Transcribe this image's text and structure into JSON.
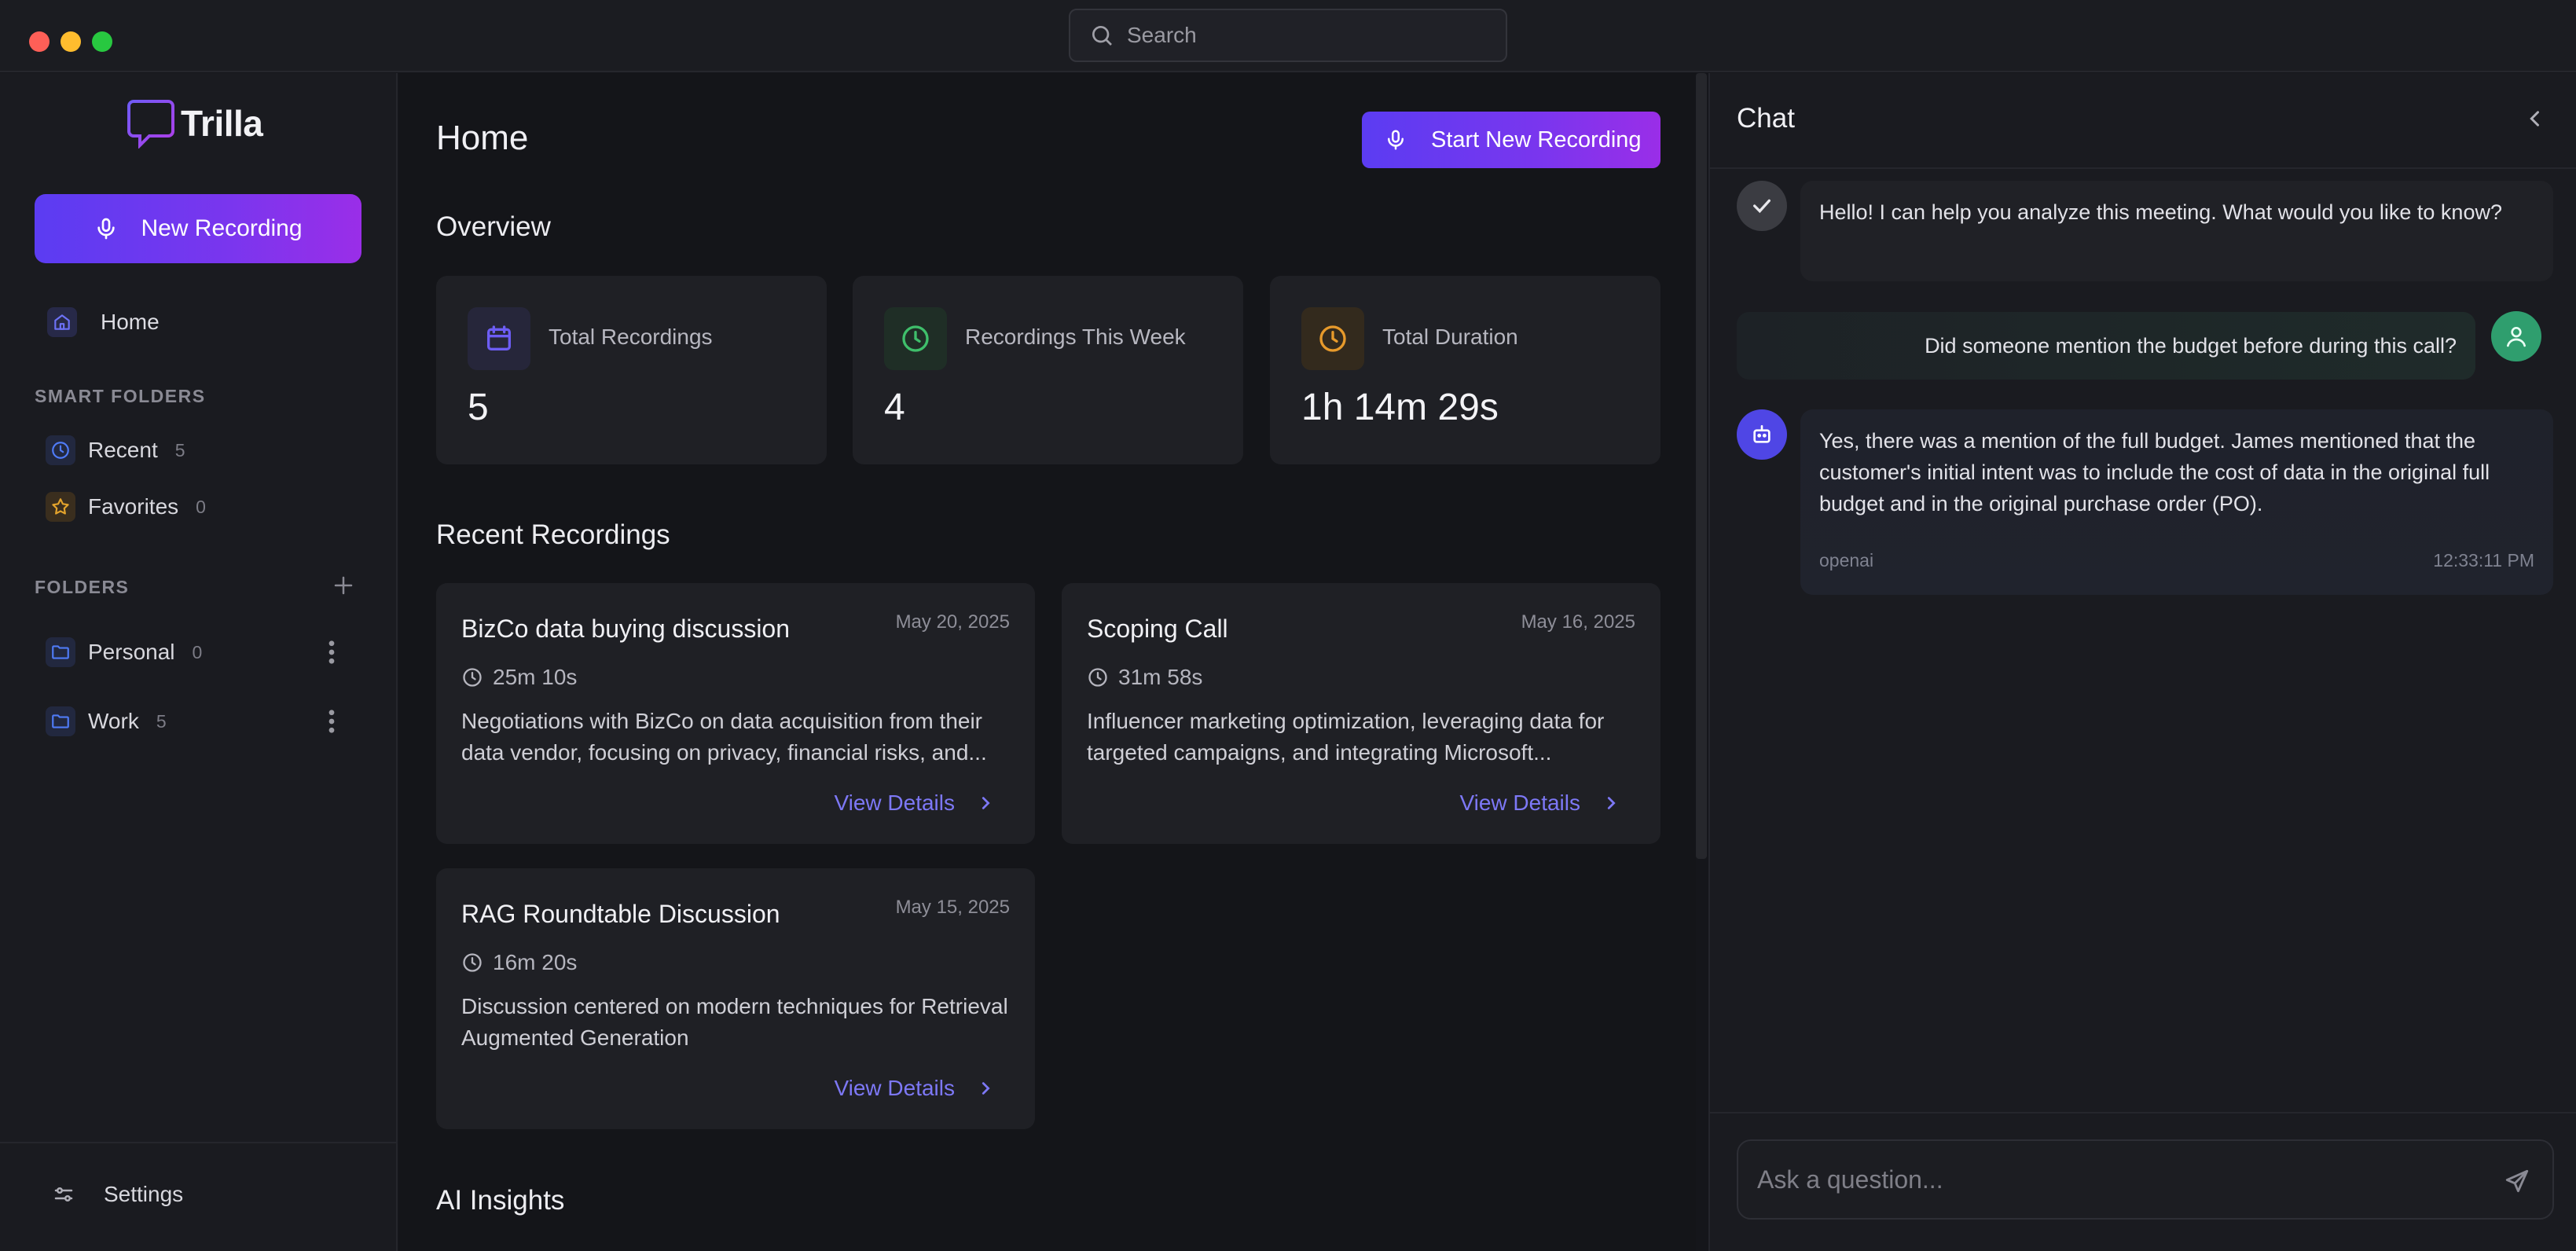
{
  "search": {
    "placeholder": "Search"
  },
  "sidebar": {
    "app_name": "Trilla",
    "new_recording_label": "New Recording",
    "home_label": "Home",
    "smart_folders_label": "SMART FOLDERS",
    "smart_folders": [
      {
        "label": "Recent",
        "count": "5",
        "icon": "clock-icon",
        "color": "#4f7bf7"
      },
      {
        "label": "Favorites",
        "count": "0",
        "icon": "star-icon",
        "color": "#e3a32c"
      }
    ],
    "folders_label": "FOLDERS",
    "folders": [
      {
        "label": "Personal",
        "count": "0",
        "icon": "folder-icon"
      },
      {
        "label": "Work",
        "count": "5",
        "icon": "folder-icon"
      }
    ],
    "settings_label": "Settings"
  },
  "main": {
    "title": "Home",
    "start_recording_label": "Start New Recording",
    "overview_label": "Overview",
    "stats": [
      {
        "label": "Total Recordings",
        "value": "5",
        "icon": "calendar-icon",
        "color": "#6d5df5"
      },
      {
        "label": "Recordings This Week",
        "value": "4",
        "icon": "clock-icon",
        "color": "#3fbf6b"
      },
      {
        "label": "Total Duration",
        "value": "1h 14m 29s",
        "icon": "clock-icon",
        "color": "#e79a2b"
      }
    ],
    "recent_label": "Recent Recordings",
    "recordings": [
      {
        "title": "BizCo data buying discussion",
        "date": "May 20, 2025",
        "duration": "25m 10s",
        "description": "Negotiations with BizCo on data acquisition from their data vendor, focusing on privacy, financial risks, and...",
        "link": "View Details"
      },
      {
        "title": "Scoping Call",
        "date": "May 16, 2025",
        "duration": "31m 58s",
        "description": "Influencer marketing optimization, leveraging data for targeted campaigns, and integrating Microsoft...",
        "link": "View Details"
      },
      {
        "title": "RAG Roundtable Discussion",
        "date": "May 15, 2025",
        "duration": "16m 20s",
        "description": "Discussion centered on modern techniques for Retrieval Augmented Generation",
        "link": "View Details"
      }
    ],
    "ai_insights_label": "AI Insights"
  },
  "chat": {
    "title": "Chat",
    "messages": [
      {
        "role": "assistant",
        "text": "Hello! I can help you analyze this meeting. What would you like to know?"
      },
      {
        "role": "user",
        "text": "Did someone mention the budget before during this call?"
      },
      {
        "role": "assistant",
        "text": "Yes, there was a mention of the full budget. James mentioned that the customer's initial intent was to include the cost of data in the original full budget and in the original purchase order (PO).",
        "model": "openai",
        "time": "12:33:11 PM"
      }
    ],
    "input_placeholder": "Ask a question..."
  },
  "colors": {
    "accent_start": "#5b3cf2",
    "accent_end": "#9a2ee8",
    "link": "#7d78f6",
    "user_avatar": "#2f9e6e",
    "bot_avatar": "#4f46e5"
  }
}
